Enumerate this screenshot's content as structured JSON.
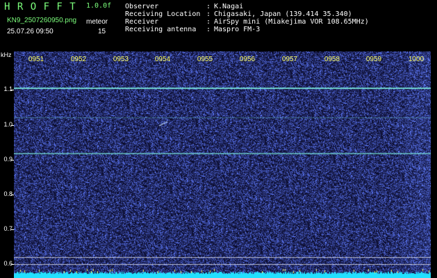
{
  "app": {
    "title": "H R O F F T",
    "version": "1.0.0f",
    "filename": "KN9_2507260950.png",
    "datetime": "25.07.26 09:50",
    "mode_label": "meteor",
    "mode_value": "15"
  },
  "info": [
    {
      "label": "Observer",
      "value": "K.Nagai"
    },
    {
      "label": "Receiving Location",
      "value": "Chigasaki, Japan (139.414 35.340)"
    },
    {
      "label": "Receiver",
      "value": "AirSpy mini (Miakejima VOR 108.65MHz)"
    },
    {
      "label": "Receiving antenna",
      "value": "Maspro FM-3"
    }
  ],
  "axis": {
    "unit": "kHz",
    "y_ticks": [
      "1.1",
      "1.0",
      "0.9",
      "0.8",
      "0.7",
      "0.6"
    ],
    "x_ticks": [
      "0951",
      "0952",
      "0953",
      "0954",
      "0955",
      "0956",
      "0957",
      "0958",
      "0959",
      "1000"
    ]
  },
  "colors": {
    "background": "#05051f",
    "noise": "#2a3ecf",
    "carrier": "#7ef2e0",
    "baseline": "#22e0ff",
    "label": "#ffff66",
    "header_green": "#7cff7c"
  }
}
